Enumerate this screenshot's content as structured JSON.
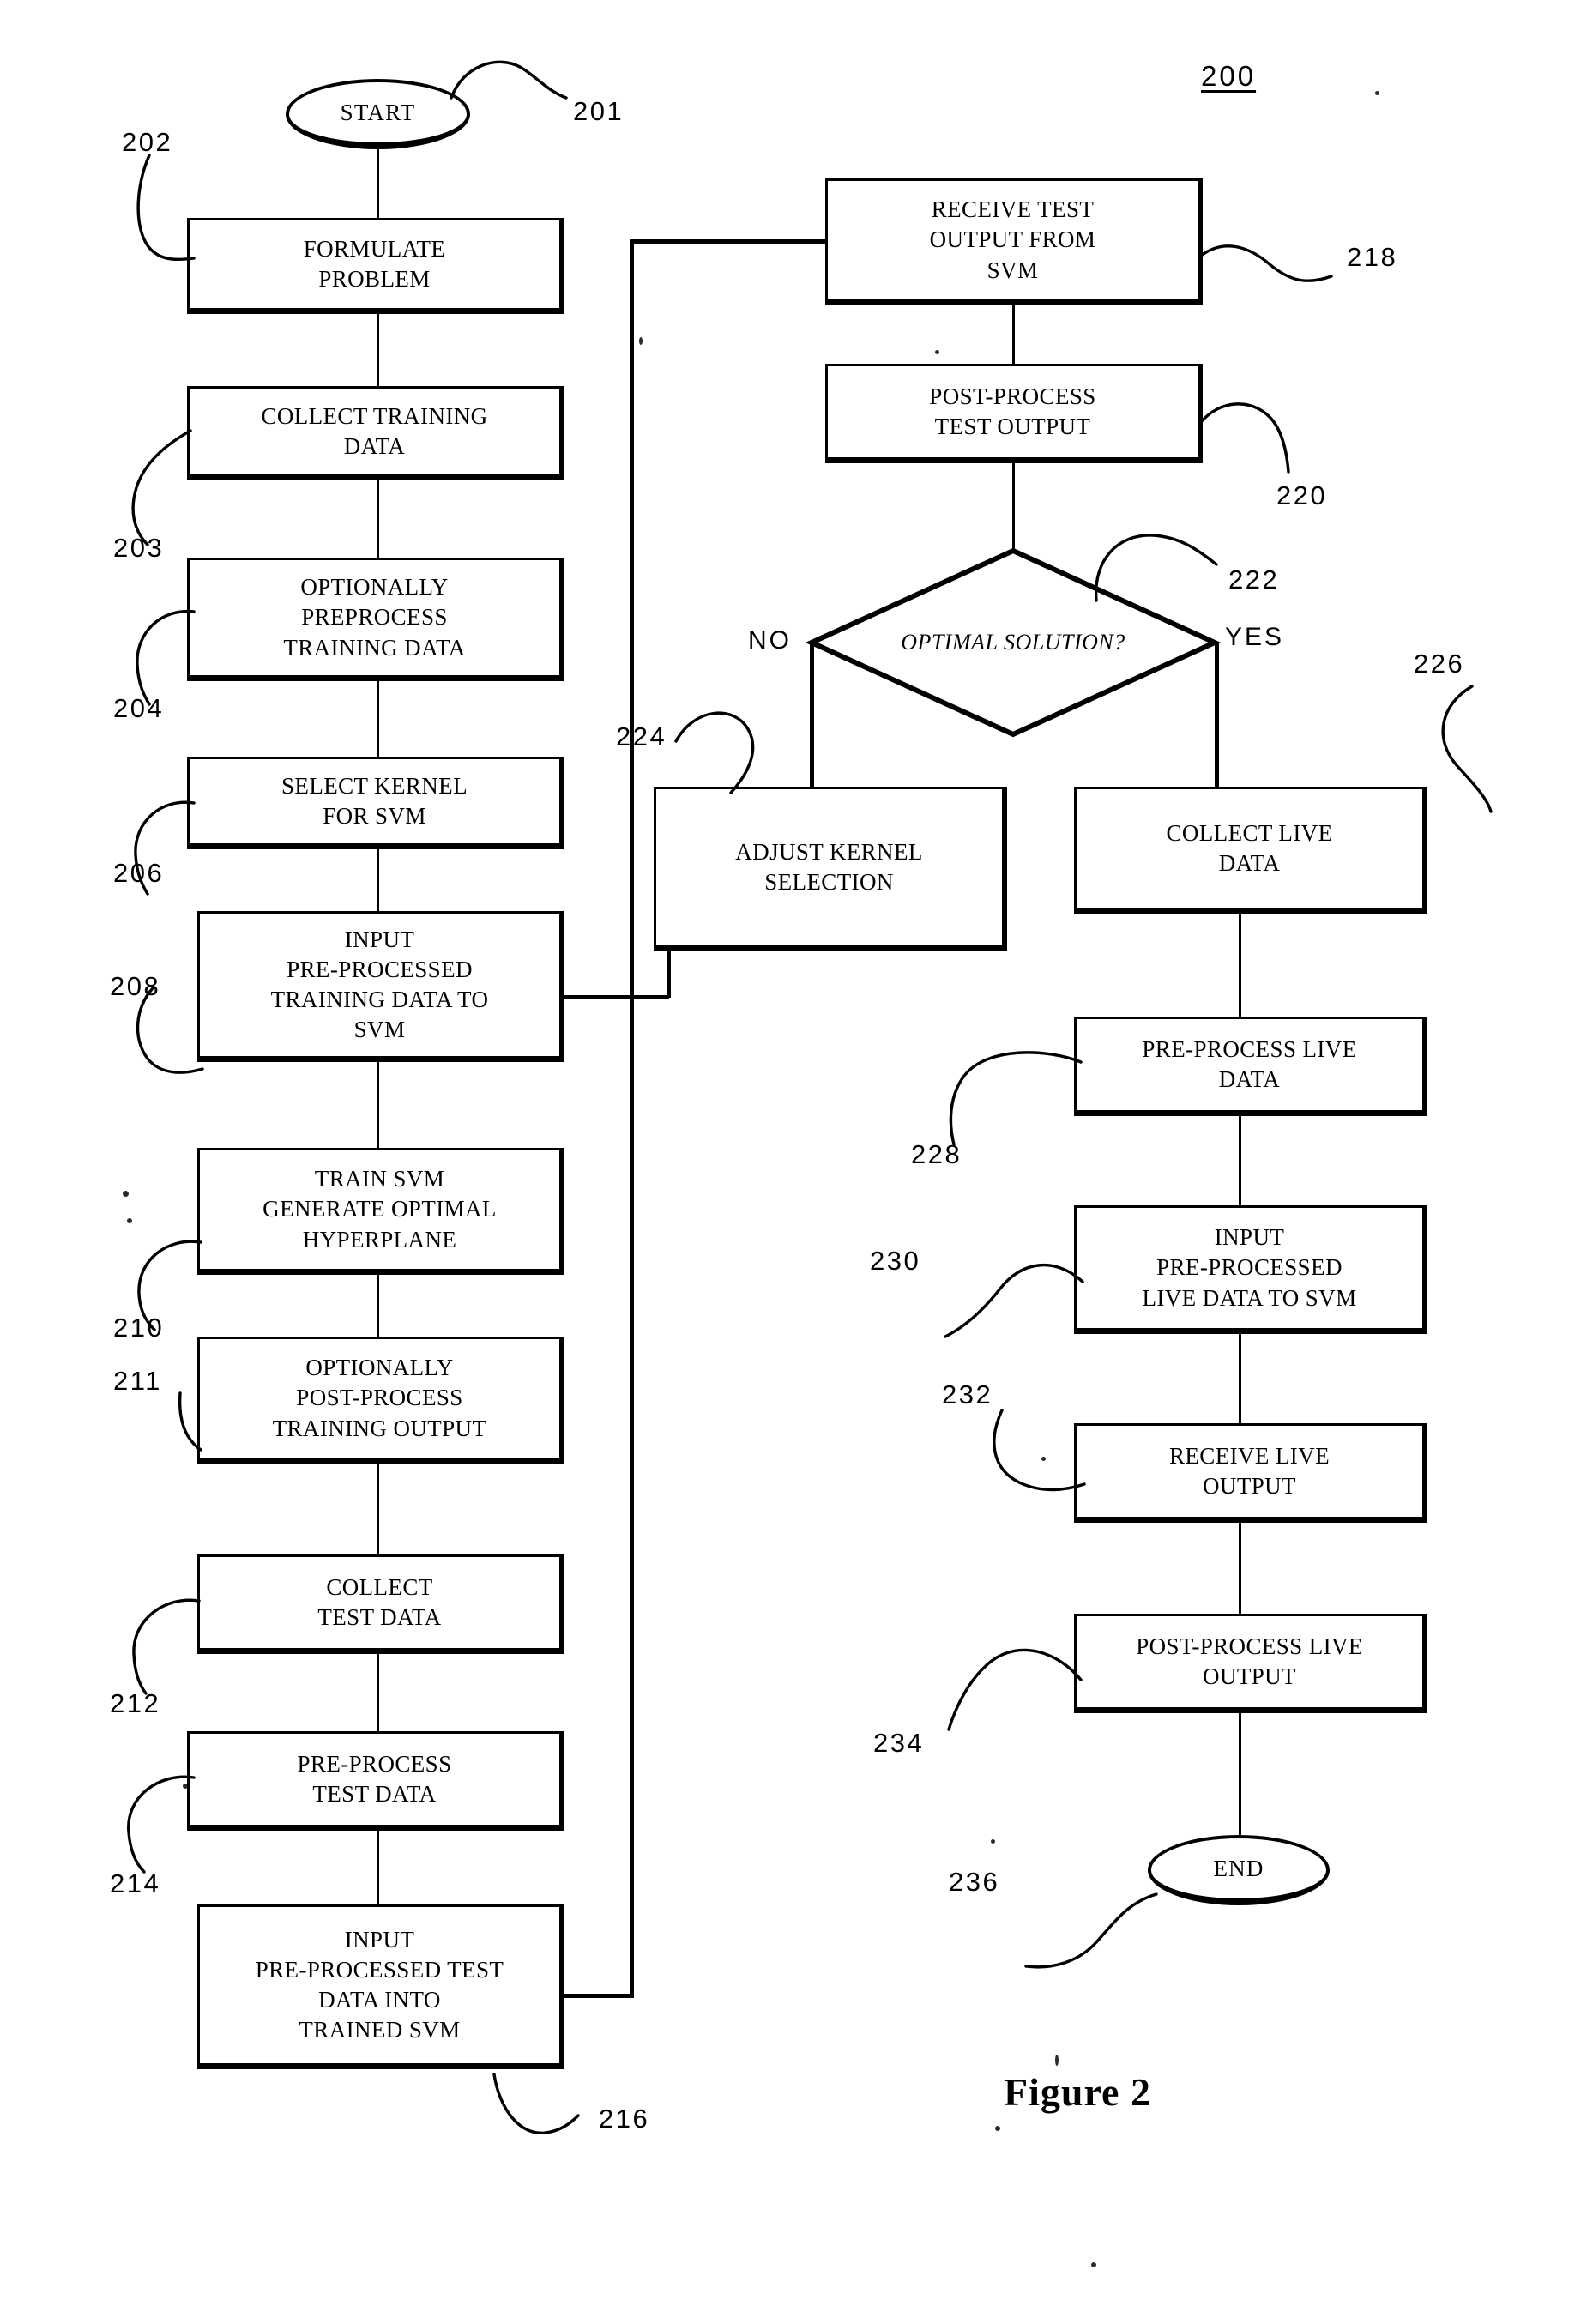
{
  "figure": {
    "caption": "Figure 2",
    "figure_number": "200"
  },
  "branch_labels": {
    "no": "NO",
    "yes": "YES"
  },
  "terminals": [
    {
      "id": "start",
      "label": "START",
      "ref": "201"
    },
    {
      "id": "end",
      "label": "END",
      "ref": "236"
    }
  ],
  "decision": {
    "id": "optimal_solution",
    "label": "OPTIMAL SOLUTION?",
    "ref": "222"
  },
  "nodes": [
    {
      "id": "formulate_problem",
      "label": "FORMULATE\nPROBLEM",
      "ref": "202"
    },
    {
      "id": "collect_training_data",
      "label": "COLLECT TRAINING\nDATA",
      "ref": "203"
    },
    {
      "id": "preprocess_training",
      "label": "OPTIONALLY\nPREPROCESS\nTRAINING DATA",
      "ref": "204"
    },
    {
      "id": "select_kernel",
      "label": "SELECT KERNEL\nFOR SVM",
      "ref": "206"
    },
    {
      "id": "input_training_to_svm",
      "label": "INPUT\nPRE-PROCESSED\nTRAINING DATA TO\nSVM",
      "ref": "208"
    },
    {
      "id": "train_svm",
      "label": "TRAIN SVM\nGENERATE OPTIMAL\nHYPERPLANE",
      "ref": "210"
    },
    {
      "id": "postprocess_training",
      "label": "OPTIONALLY\nPOST-PROCESS\nTRAINING OUTPUT",
      "ref": "211"
    },
    {
      "id": "collect_test_data",
      "label": "COLLECT\nTEST DATA",
      "ref": "212"
    },
    {
      "id": "preprocess_test_data",
      "label": "PRE-PROCESS\nTEST DATA",
      "ref": "214"
    },
    {
      "id": "input_test_to_svm",
      "label": "INPUT\nPRE-PROCESSED TEST\nDATA INTO\nTRAINED SVM",
      "ref": "216"
    },
    {
      "id": "receive_test_output",
      "label": "RECEIVE TEST\nOUTPUT FROM\nSVM",
      "ref": "218"
    },
    {
      "id": "postprocess_test_output",
      "label": "POST-PROCESS\nTEST OUTPUT",
      "ref": "220"
    },
    {
      "id": "adjust_kernel",
      "label": "ADJUST KERNEL\nSELECTION",
      "ref": "224"
    },
    {
      "id": "collect_live_data",
      "label": "COLLECT LIVE\nDATA",
      "ref": "226"
    },
    {
      "id": "preprocess_live_data",
      "label": "PRE-PROCESS LIVE\nDATA",
      "ref": "228"
    },
    {
      "id": "input_live_to_svm",
      "label": "INPUT\nPRE-PROCESSED\nLIVE DATA TO SVM",
      "ref": "230"
    },
    {
      "id": "receive_live_output",
      "label": "RECEIVE LIVE\nOUTPUT",
      "ref": "232"
    },
    {
      "id": "postprocess_live_output",
      "label": "POST-PROCESS LIVE\nOUTPUT",
      "ref": "234"
    }
  ]
}
